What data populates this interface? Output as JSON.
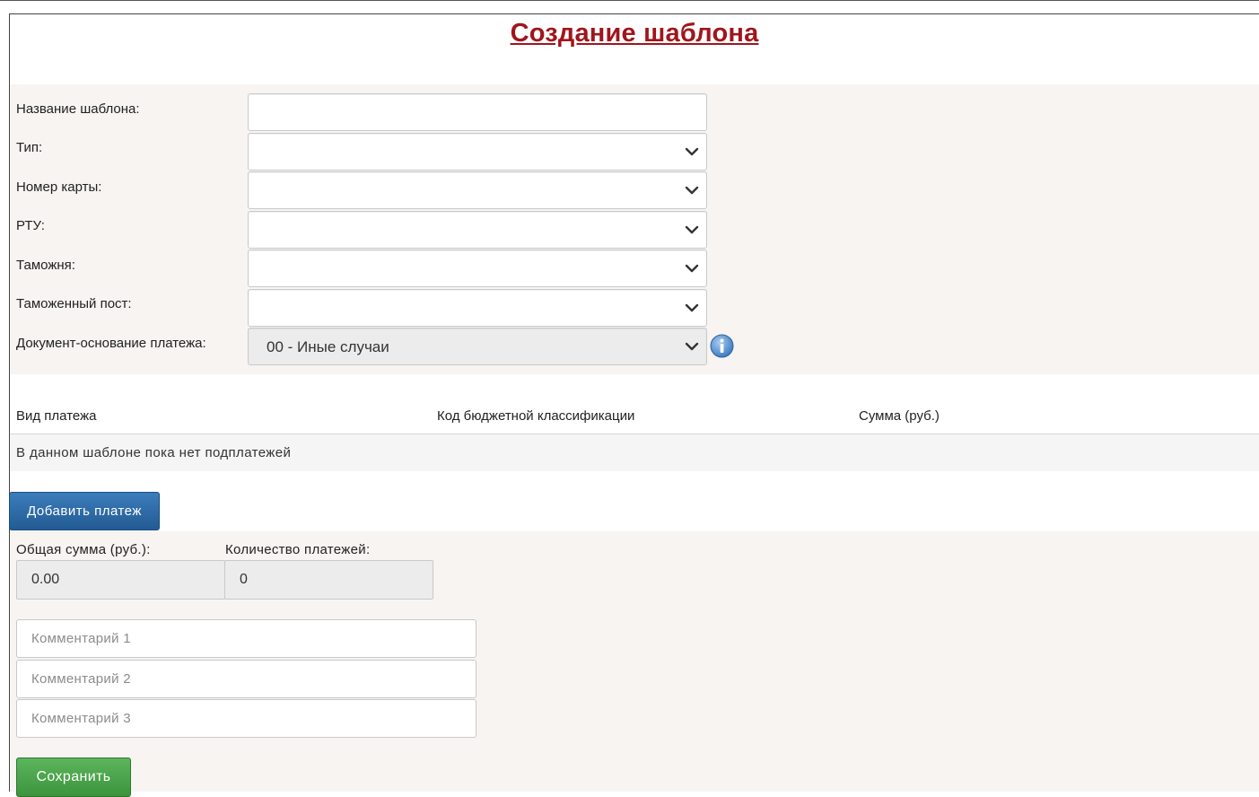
{
  "title": "Создание шаблона",
  "form": {
    "template_name": {
      "label": "Название шаблона:",
      "value": ""
    },
    "type": {
      "label": "Тип:",
      "value": ""
    },
    "card_number": {
      "label": "Номер карты:",
      "value": ""
    },
    "rtu": {
      "label": "РТУ:",
      "value": ""
    },
    "customs": {
      "label": "Таможня:",
      "value": ""
    },
    "customs_post": {
      "label": "Таможенный пост:",
      "value": ""
    },
    "payment_basis": {
      "label": "Документ-основание платежа:",
      "value": "00 - Иные случаи"
    }
  },
  "icons": {
    "dropdown": "chevron-down-icon",
    "info": "info-icon"
  },
  "table": {
    "columns": [
      "Вид платежа",
      "Код бюджетной классификации",
      "Сумма (руб.)"
    ],
    "empty_message": "В данном шаблоне пока нет подплатежей"
  },
  "buttons": {
    "add_payment": "Добавить платеж",
    "save": "Сохранить"
  },
  "summary": {
    "total_label": "Общая сумма (руб.):",
    "total_value": "0.00",
    "count_label": "Количество платежей:",
    "count_value": "0"
  },
  "comments": [
    {
      "placeholder": "Комментарий 1",
      "value": ""
    },
    {
      "placeholder": "Комментарий 2",
      "value": ""
    },
    {
      "placeholder": "Комментарий 3",
      "value": ""
    }
  ],
  "colors": {
    "title": "#a0151c",
    "panel_bg": "#f7f4f2",
    "add_button": "#2a649e",
    "save_button": "#46a046",
    "info_icon": "#4a86c8"
  }
}
